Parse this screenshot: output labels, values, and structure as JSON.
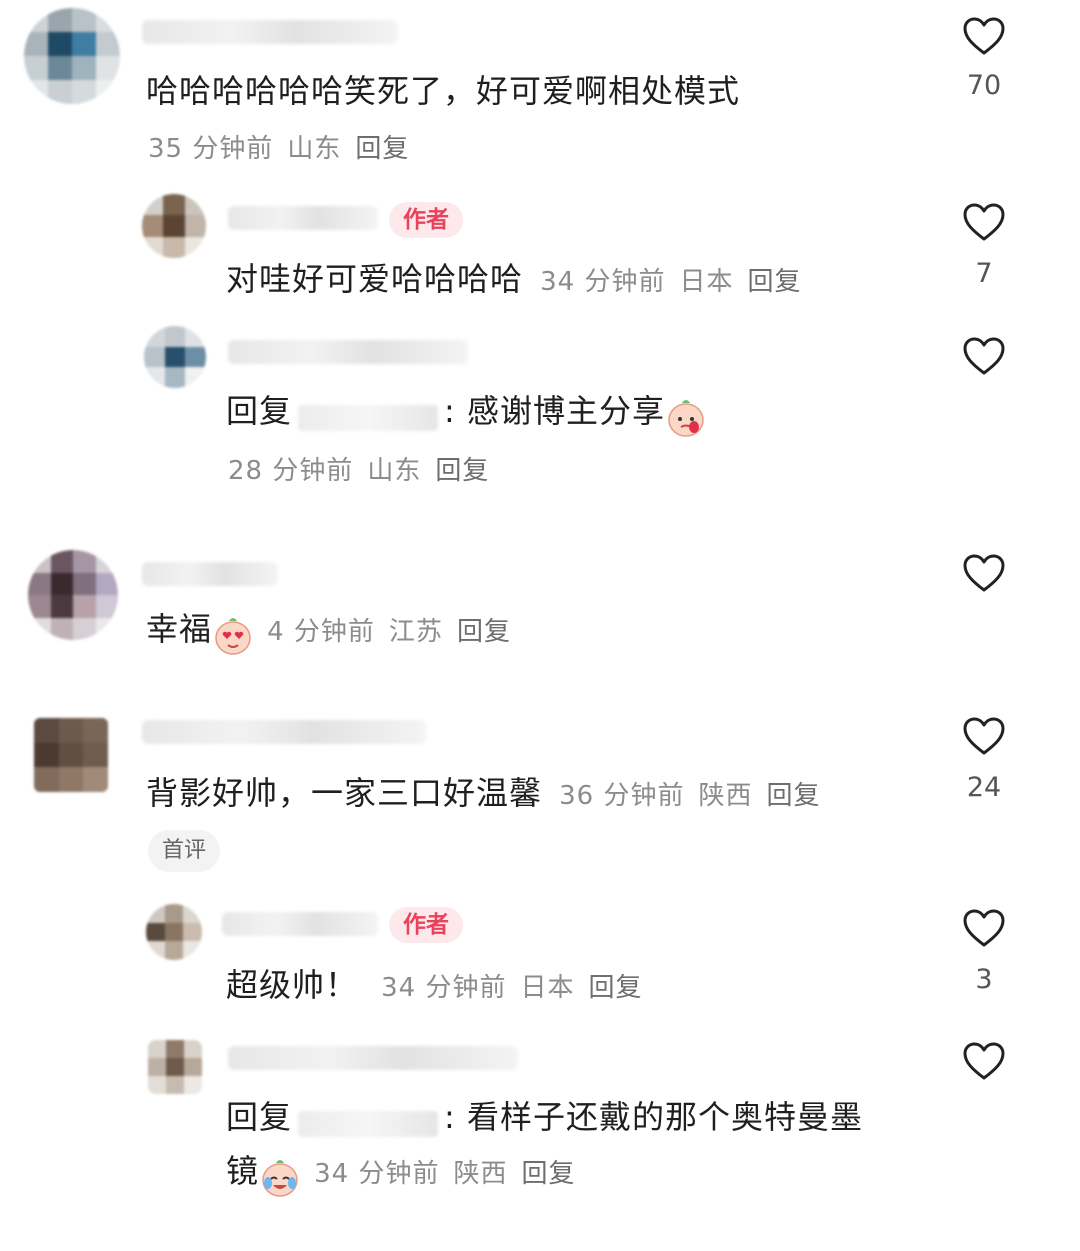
{
  "comments": [
    {
      "text": "哈哈哈哈哈哈笑死了，好可爱啊相处模式",
      "time": "35 分钟前",
      "location": "山东",
      "reply_label": "回复",
      "likes": "70",
      "replies": [
        {
          "author_tag": "作者",
          "text": "对哇好可爱哈哈哈哈",
          "time": "34 分钟前",
          "location": "日本",
          "reply_label": "回复",
          "likes": "7"
        },
        {
          "reply_prefix": "回复",
          "text": ": 感谢博主分享",
          "time": "28 分钟前",
          "location": "山东",
          "reply_label": "回复",
          "likes": ""
        }
      ]
    },
    {
      "text": "幸福",
      "time": "4 分钟前",
      "location": "江苏",
      "reply_label": "回复",
      "likes": ""
    },
    {
      "text": "背影好帅，一家三口好温馨",
      "time": "36 分钟前",
      "location": "陕西",
      "reply_label": "回复",
      "likes": "24",
      "badge": "首评",
      "replies": [
        {
          "author_tag": "作者",
          "text": "超级帅！",
          "time": "34 分钟前",
          "location": "日本",
          "reply_label": "回复",
          "likes": "3"
        },
        {
          "reply_prefix": "回复",
          "text": ": 看样子还戴的那个奥特曼墨",
          "text_cont": "镜",
          "time": "34 分钟前",
          "location": "陕西",
          "reply_label": "回复",
          "likes": ""
        }
      ]
    }
  ],
  "colors": {
    "author_tag_bg": "#fde9ec",
    "author_tag_text": "#e8425c",
    "meta_text": "#8c8c8c"
  },
  "icons": [
    "heart-outline-icon",
    "crying-emoji-icon",
    "heart-eyes-emoji-icon",
    "laughing-tears-emoji-icon"
  ]
}
